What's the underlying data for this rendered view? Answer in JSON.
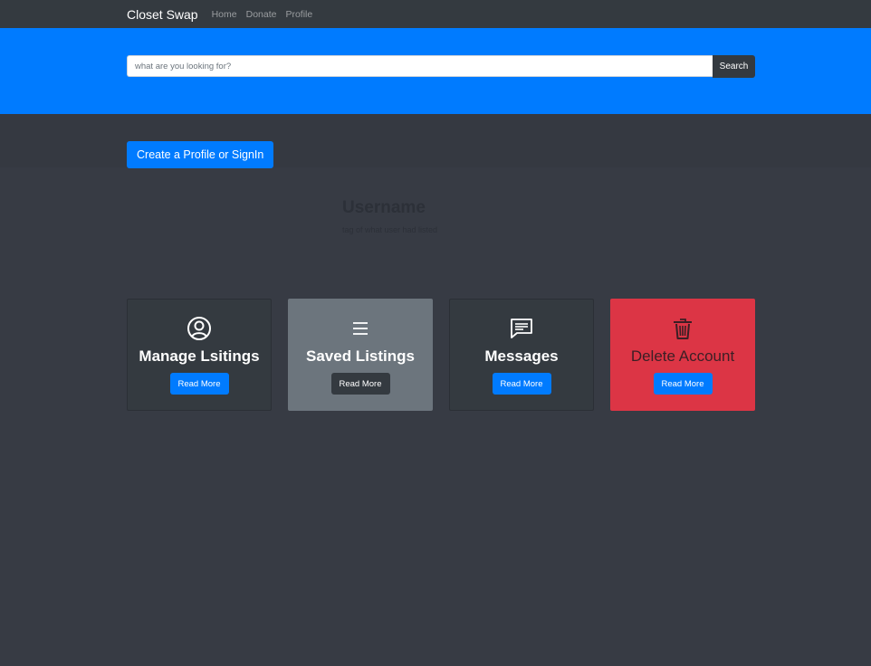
{
  "navbar": {
    "brand": "Closet Swap",
    "links": [
      "Home",
      "Donate",
      "Profile"
    ]
  },
  "search": {
    "placeholder": "what are you looking for?",
    "button_label": "Search"
  },
  "cta": {
    "label": "Create a Profile or SignIn"
  },
  "profile": {
    "username": "Username",
    "tagline": "tag of what user had listed"
  },
  "cards": [
    {
      "title": "Manage Lsitings",
      "icon": "user-circle-icon",
      "button": "Read More"
    },
    {
      "title": "Saved Listings",
      "icon": "list-icon",
      "button": "Read More"
    },
    {
      "title": "Messages",
      "icon": "message-icon",
      "button": "Read More"
    },
    {
      "title": "Delete Account",
      "icon": "trash-icon",
      "button": "Read More"
    }
  ],
  "colors": {
    "primary": "#007bff",
    "dark": "#343a40",
    "secondary": "#6c757d",
    "danger": "#dc3545",
    "background": "#373b44"
  }
}
